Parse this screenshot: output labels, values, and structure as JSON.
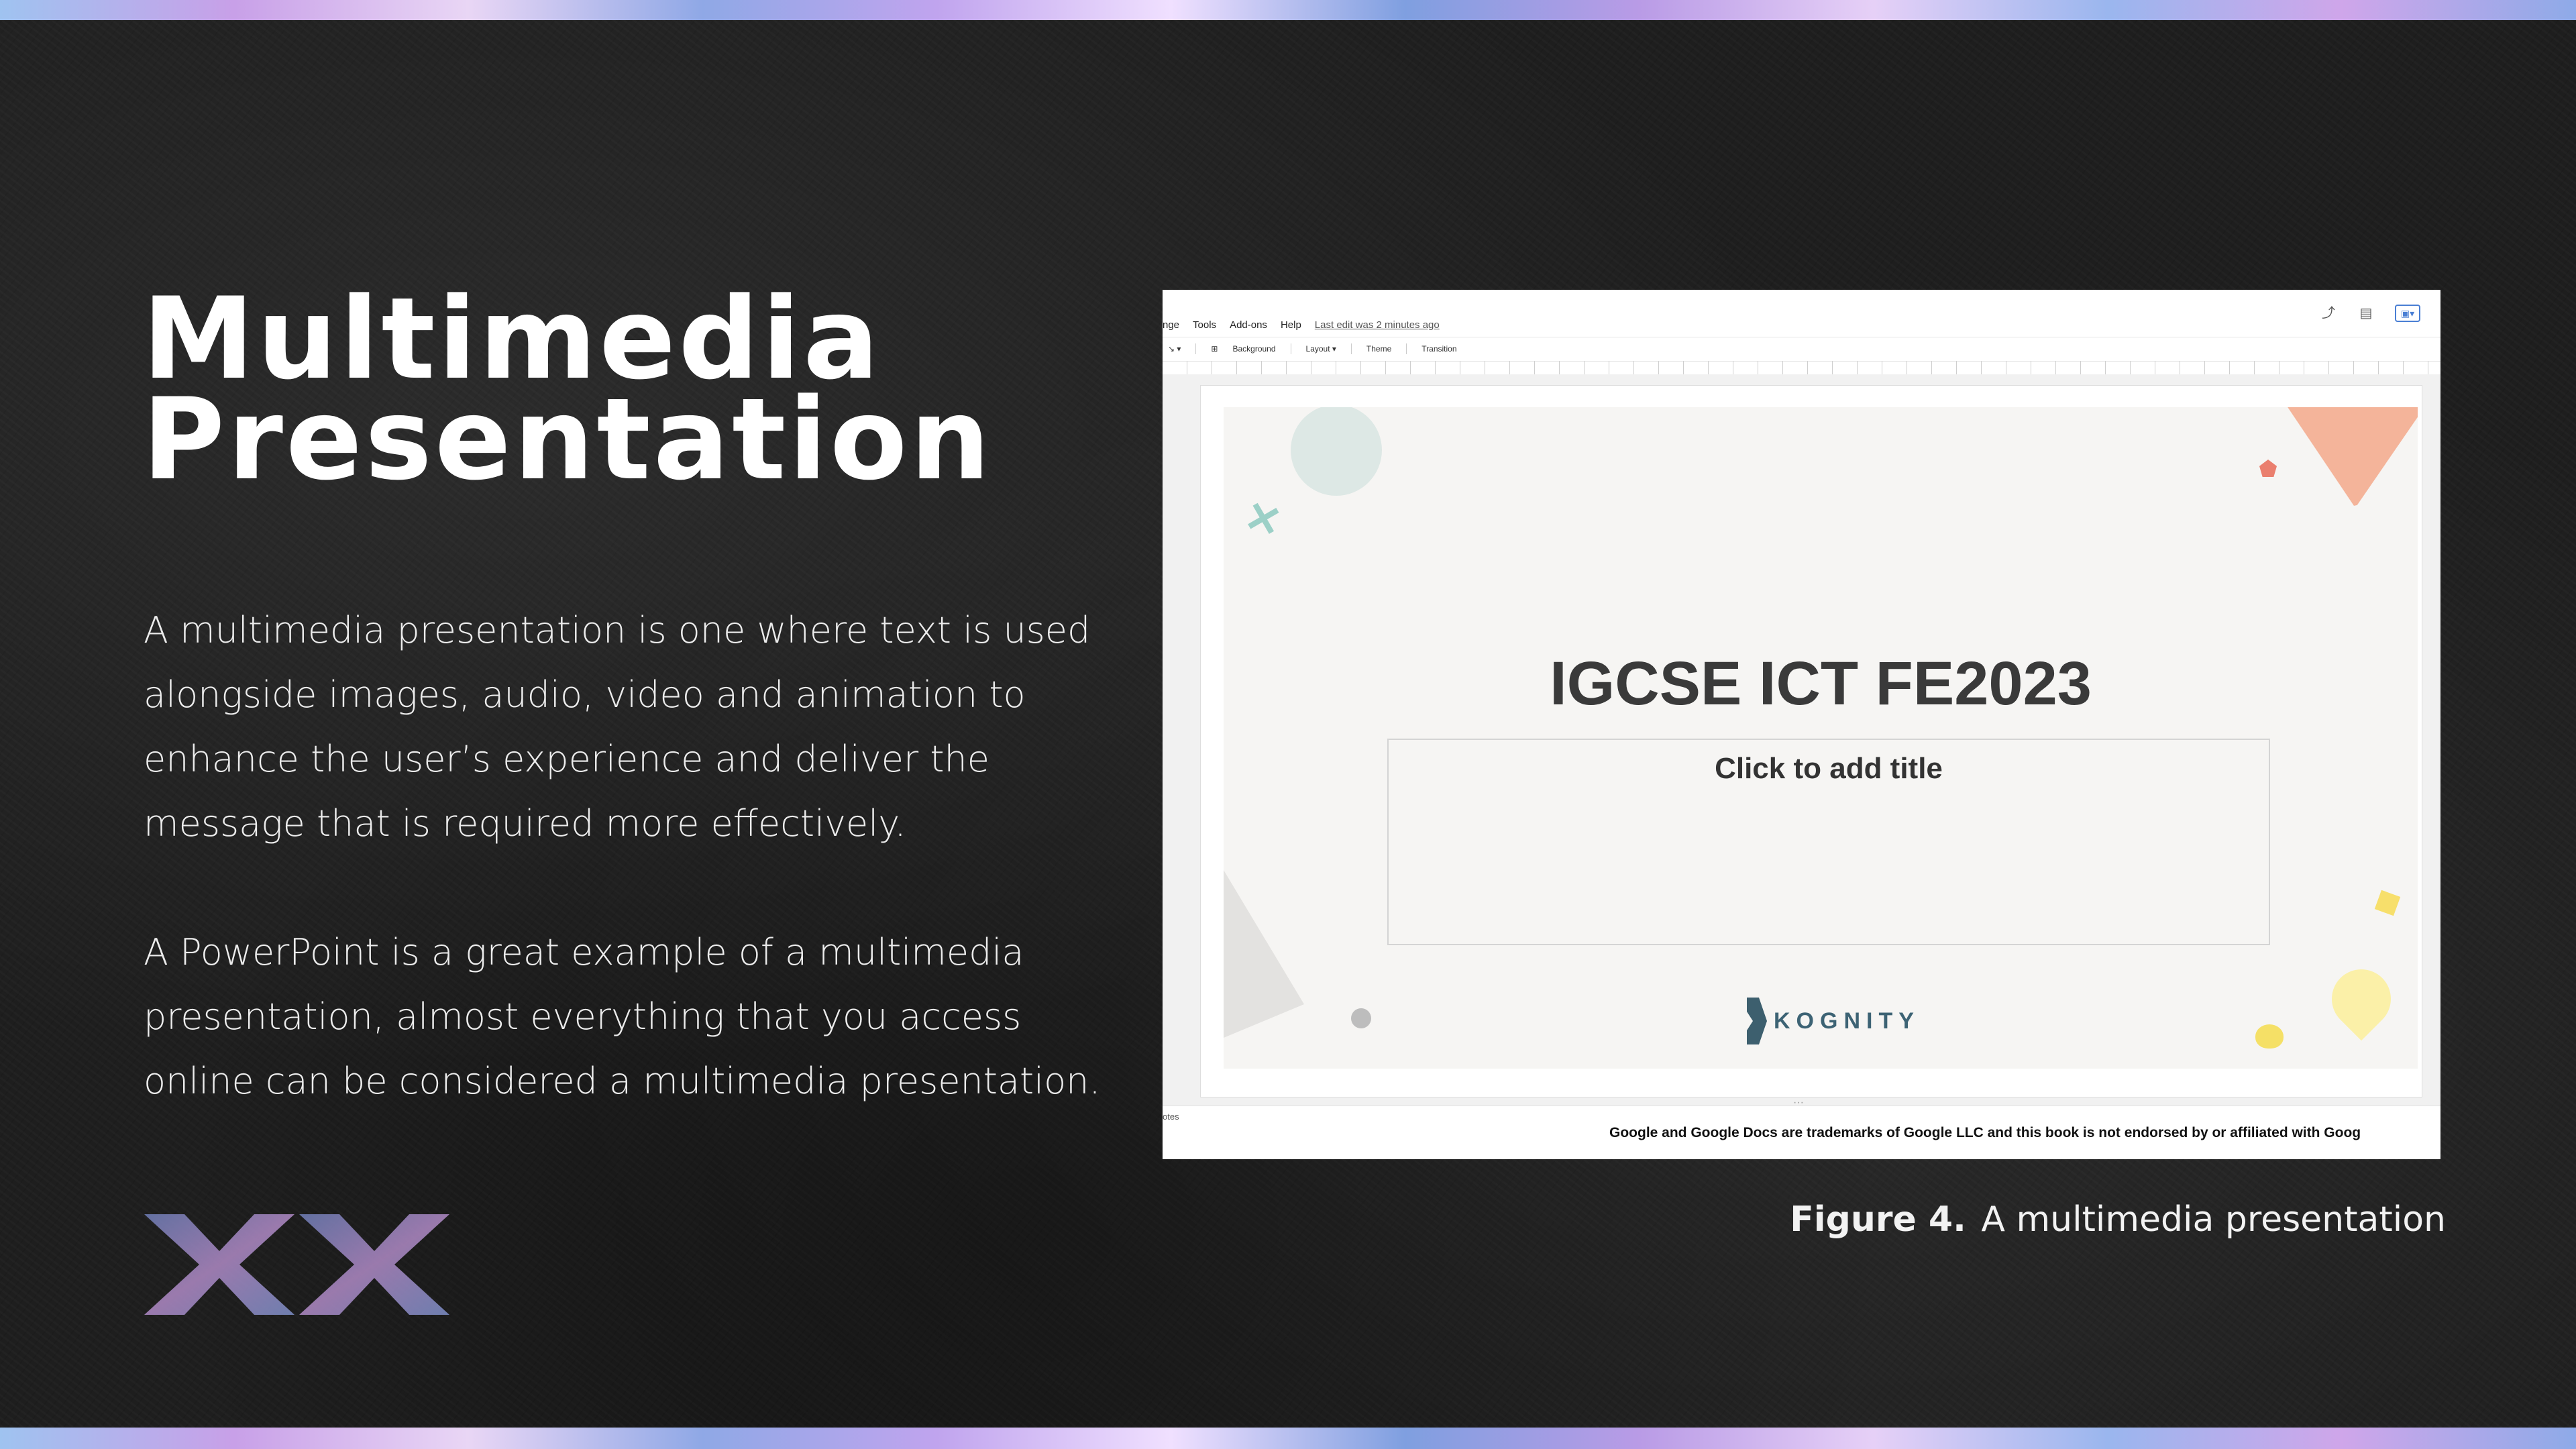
{
  "slide": {
    "title_line1": "Multimedia",
    "title_line2": "Presentation",
    "paragraph1": "A multimedia presentation is one where text is used alongside images, audio, video and animation to enhance the user’s experience and deliver the message that is required more effectively.",
    "paragraph2": "A PowerPoint is a great example of a multimedia presentation, almost everything that you access online can be considered a multimedia presentation.",
    "caption_label": "Figure 4.",
    "caption_text": "A multimedia presentation"
  },
  "screenshot": {
    "menu": [
      "nge",
      "Tools",
      "Add-ons",
      "Help"
    ],
    "last_edit": "Last edit was 2 minutes ago",
    "toolbar": [
      "Background",
      "Layout ▾",
      "Theme",
      "Transition"
    ],
    "slide_title": "IGCSE ICT FE2023",
    "slide_placeholder": "Click to add title",
    "logo_text": "KOGNITY",
    "notes_label": "otes",
    "disclaimer": "Google and Google Docs are trademarks of Google LLC and this book is not endorsed by or affiliated with Goog"
  },
  "colors": {
    "background": "#1e1e1e",
    "title": "#ffffff",
    "accent_strip": "#c0a4ee"
  },
  "icons": [
    "trend-icon",
    "comment-icon",
    "present-icon",
    "line-tool-icon",
    "textbox-icon"
  ]
}
